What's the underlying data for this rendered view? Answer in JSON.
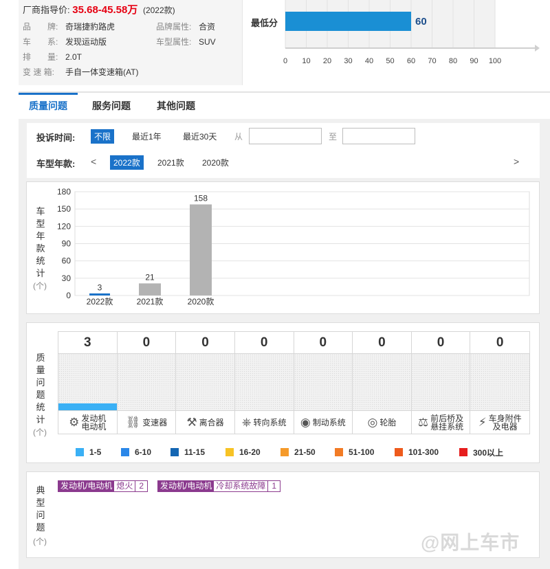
{
  "price": {
    "label": "厂商指导价:",
    "value": "35.68-45.58万",
    "year": "(2022款)"
  },
  "specs": [
    {
      "k": "品　　牌:",
      "v": "奇瑞捷豹路虎"
    },
    {
      "k": "品牌属性:",
      "v": "合资"
    },
    {
      "k": "车　　系:",
      "v": "发现运动版"
    },
    {
      "k": "车型属性:",
      "v": "SUV"
    },
    {
      "k": "排　　量:",
      "v": "2.0T"
    },
    {
      "k": "变 速 箱:",
      "v": "手自一体变速箱(AT)"
    }
  ],
  "min_score": {
    "label": "最低分",
    "chart_data": {
      "type": "bar",
      "orientation": "horizontal",
      "categories": [
        "最低分"
      ],
      "values": [
        60
      ],
      "xlim": [
        0,
        100
      ],
      "xticks": [
        0,
        10,
        20,
        30,
        40,
        50,
        60,
        70,
        80,
        90,
        100
      ],
      "data_labels": [
        "60"
      ],
      "color": "#1a8fd4"
    }
  },
  "tabs": [
    {
      "label": "质量问题",
      "active": true
    },
    {
      "label": "服务问题",
      "active": false
    },
    {
      "label": "其他问题",
      "active": false
    }
  ],
  "filter": {
    "time_label": "投诉时间:",
    "time_options": [
      "不限",
      "最近1年",
      "最近30天"
    ],
    "from": "从",
    "to": "至",
    "year_label": "车型年款:",
    "prev": "<",
    "next": ">",
    "year_options": [
      "2022款",
      "2021款",
      "2020款"
    ]
  },
  "year_stats": {
    "label_chars": [
      "车",
      "型",
      "年",
      "款",
      "统",
      "计"
    ],
    "unit": "(个)",
    "chart_data": {
      "type": "bar",
      "categories": [
        "2022款",
        "2021款",
        "2020款"
      ],
      "values": [
        3,
        21,
        158
      ],
      "ylim": [
        0,
        180
      ],
      "yticks": [
        0,
        30,
        60,
        90,
        120,
        150,
        180
      ],
      "data_labels": [
        "3",
        "21",
        "158"
      ],
      "colors": [
        "#1a72c9",
        "#b3b3b3",
        "#b3b3b3"
      ],
      "grid": true
    }
  },
  "quality_stats": {
    "label_chars": [
      "质",
      "量",
      "问",
      "题",
      "统",
      "计"
    ],
    "unit": "(个)",
    "columns": [
      {
        "count": "3",
        "value": 3,
        "label": "发动机\n电动机",
        "icon": "engine-icon",
        "glyph": "⚙"
      },
      {
        "count": "0",
        "value": 0,
        "label": "变速器",
        "icon": "gear-shift-icon",
        "glyph": "⚙"
      },
      {
        "count": "0",
        "value": 0,
        "label": "离合器",
        "icon": "clutch-pedal-icon",
        "glyph": "⚙"
      },
      {
        "count": "0",
        "value": 0,
        "label": "转向系统",
        "icon": "steering-wheel-icon",
        "glyph": "⚙"
      },
      {
        "count": "0",
        "value": 0,
        "label": "制动系统",
        "icon": "brake-disc-icon",
        "glyph": "⚙"
      },
      {
        "count": "0",
        "value": 0,
        "label": "轮胎",
        "icon": "tire-icon",
        "glyph": "⚙"
      },
      {
        "count": "0",
        "value": 0,
        "label": "前后桥及\n悬挂系统",
        "icon": "suspension-icon",
        "glyph": "⚙"
      },
      {
        "count": "0",
        "value": 0,
        "label": "车身附件\n及电器",
        "icon": "battery-icon",
        "glyph": "⚙"
      }
    ],
    "legend": [
      {
        "label": "1-5",
        "color": "#3ab0f5"
      },
      {
        "label": "6-10",
        "color": "#2b87e8"
      },
      {
        "label": "11-15",
        "color": "#1466b3"
      },
      {
        "label": "16-20",
        "color": "#f7c325"
      },
      {
        "label": "21-50",
        "color": "#f59a2a"
      },
      {
        "label": "51-100",
        "color": "#f27b25"
      },
      {
        "label": "101-300",
        "color": "#ee5a1c"
      },
      {
        "label": "300以上",
        "color": "#e61e1e"
      }
    ]
  },
  "typical": {
    "label_chars": [
      "典",
      "型",
      "问",
      "题"
    ],
    "unit": "(个)",
    "tags": [
      {
        "category": "发动机/电动机",
        "issue": "熄火",
        "count": "2"
      },
      {
        "category": "发动机/电动机",
        "issue": "冷却系统故障",
        "count": "1"
      }
    ]
  },
  "watermark": "@网上车市"
}
